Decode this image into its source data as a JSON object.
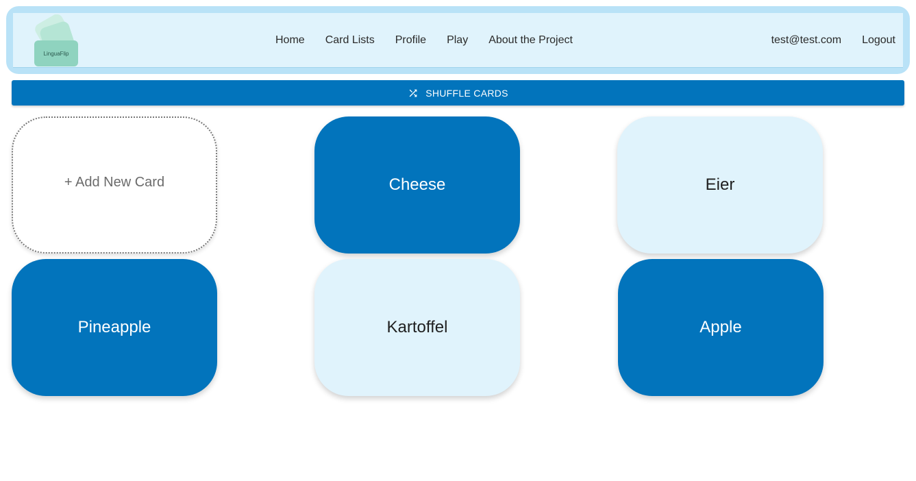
{
  "app": {
    "logo_text": "LinguaFlip"
  },
  "nav": {
    "links": [
      "Home",
      "Card Lists",
      "Profile",
      "Play",
      "About the Project"
    ],
    "user_email": "test@test.com",
    "logout_label": "Logout"
  },
  "toolbar": {
    "shuffle_label": "SHUFFLE CARDS",
    "shuffle_icon": "shuffle-icon"
  },
  "cards": {
    "add_label": "+ Add New Card",
    "items": [
      {
        "label": "Cheese",
        "style": "dark"
      },
      {
        "label": "Eier",
        "style": "light"
      },
      {
        "label": "Pineapple",
        "style": "dark"
      },
      {
        "label": "Kartoffel",
        "style": "light"
      },
      {
        "label": "Apple",
        "style": "dark"
      }
    ]
  },
  "colors": {
    "primary": "#0274bc",
    "light_card": "#e0f3fc",
    "navbar_border": "#b9e2f7",
    "logo_green": "#8fd3bf"
  }
}
